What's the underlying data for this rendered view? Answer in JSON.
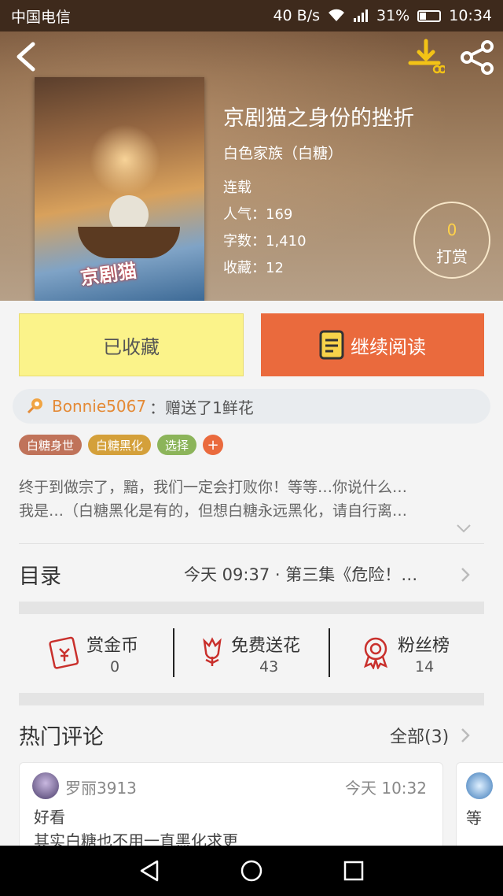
{
  "status_bar": {
    "carrier": "中国电信",
    "speed": "40 B/s",
    "network": "3G",
    "battery": "31%",
    "battery_level": 0.31,
    "time": "10:34"
  },
  "book": {
    "title": "京剧猫之身份的挫折",
    "author": "白色家族（白糖）",
    "status": "连载",
    "popularity": "人气：169",
    "word_count": "字数：1,410",
    "favorites": "收藏：12",
    "reward_count": "0",
    "reward_label": "打赏",
    "cover_logo": "京剧猫"
  },
  "actions": {
    "collected_label": "已收藏",
    "continue_label": "继续阅读"
  },
  "gift": {
    "user": "Bonnie5067",
    "text": "：赠送了1鲜花"
  },
  "tags": [
    {
      "label": "白糖身世",
      "color": "#c0735a"
    },
    {
      "label": "白糖黑化",
      "color": "#d4a03a"
    },
    {
      "label": "选择",
      "color": "#8cb45a"
    }
  ],
  "tag_add_label": "+",
  "synopsis": {
    "line1": "终于到做宗了，黯，我们一定会打败你！等等…你说什么…",
    "line2": "我是…（白糖黑化是有的，但想白糖永远黑化，请自行离…"
  },
  "toc": {
    "label": "目录",
    "latest": "今天 09:37 · 第三集《危险！…"
  },
  "stats": [
    {
      "name": "赏金币",
      "value": "0",
      "icon": "coin-envelope-icon"
    },
    {
      "name": "免费送花",
      "value": "43",
      "icon": "flower-icon"
    },
    {
      "name": "粉丝榜",
      "value": "14",
      "icon": "medal-icon"
    }
  ],
  "comments_section": {
    "title": "热门评论",
    "all_label": "全部(3)"
  },
  "comments": [
    {
      "user": "罗丽3913",
      "time": "今天 10:32",
      "line1": "好看",
      "line2": "其实白糖也不用一直黑化求更"
    },
    {
      "line1": "等"
    }
  ],
  "colors": {
    "accent_orange": "#ea6a3d",
    "collected_yellow": "#fbf38a",
    "gift_orange": "#e48a36",
    "reward_gold": "#ffd24a",
    "stat_red": "#c9302c"
  }
}
